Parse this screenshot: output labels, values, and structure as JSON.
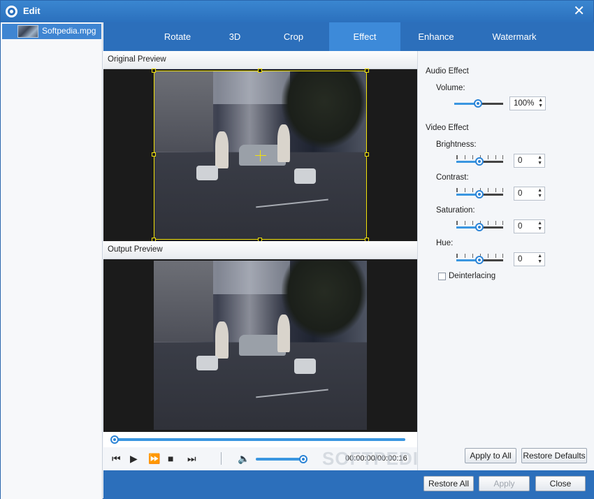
{
  "window": {
    "title": "Edit",
    "close_glyph": "✕",
    "app_icon": "film-reel-icon"
  },
  "file_list": {
    "items": [
      {
        "name": "Softpedia.mpg",
        "selected": true
      }
    ]
  },
  "tabs": [
    {
      "label": "Rotate",
      "active": false
    },
    {
      "label": "3D",
      "active": false
    },
    {
      "label": "Crop",
      "active": false
    },
    {
      "label": "Effect",
      "active": true
    },
    {
      "label": "Enhance",
      "active": false
    },
    {
      "label": "Watermark",
      "active": false
    }
  ],
  "preview": {
    "original_label": "Original Preview",
    "output_label": "Output Preview"
  },
  "playback": {
    "position_fraction": 0.0,
    "volume_fraction": 0.95,
    "timecode": "00:00:00/00:00:16",
    "icons": [
      "skip-previous-icon",
      "play-icon",
      "fast-forward-icon",
      "stop-icon",
      "skip-next-icon",
      "volume-icon"
    ]
  },
  "watermark_text": "SOFTPEDIA",
  "settings": {
    "audio_effect": {
      "heading": "Audio Effect",
      "volume_label": "Volume:",
      "volume_value": "100%",
      "volume_fraction": 0.5
    },
    "video_effect": {
      "heading": "Video Effect",
      "brightness": {
        "label": "Brightness:",
        "value": "0",
        "fraction": 0.5
      },
      "contrast": {
        "label": "Contrast:",
        "value": "0",
        "fraction": 0.5
      },
      "saturation": {
        "label": "Saturation:",
        "value": "0",
        "fraction": 0.5
      },
      "hue": {
        "label": "Hue:",
        "value": "0",
        "fraction": 0.5
      },
      "deinterlacing": {
        "label": "Deinterlacing",
        "checked": false
      }
    },
    "apply_to_all": "Apply to All",
    "restore_defaults": "Restore Defaults"
  },
  "footer": {
    "restore_all": "Restore All",
    "apply": "Apply",
    "close": "Close"
  },
  "colors": {
    "accent": "#2c6fbb",
    "active_tab": "#3d8ad9",
    "crop_frame": "#f2e20a",
    "slider_fill": "#3a96e0"
  }
}
